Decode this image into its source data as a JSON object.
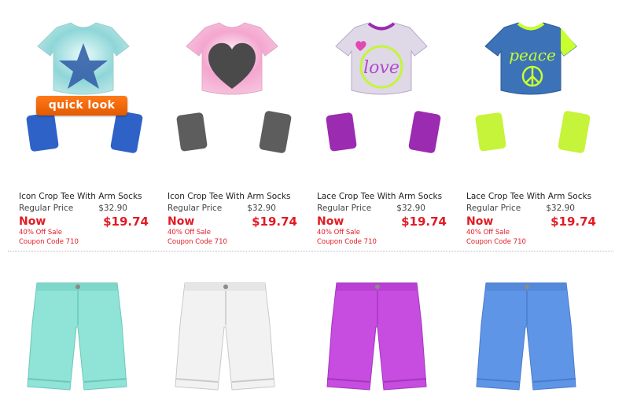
{
  "quick_look_label": "quick look",
  "products": [
    {
      "name": "Icon Crop Tee With Arm Socks",
      "regular_label": "Regular Price",
      "regular_price": "$32.90",
      "now_label": "Now",
      "sale_price": "$19.74",
      "sale_note": "40% Off Sale",
      "coupon": "Coupon Code 710",
      "icon": "star-crop-tee",
      "colors": {
        "shirt": "#8fd6d8",
        "accent": "#2f5ea8",
        "socks": "#2f62c7"
      }
    },
    {
      "name": "Icon Crop Tee With Arm Socks",
      "regular_label": "Regular Price",
      "regular_price": "$32.90",
      "now_label": "Now",
      "sale_price": "$19.74",
      "sale_note": "40% Off Sale",
      "coupon": "Coupon Code 710",
      "icon": "heart-crop-tee",
      "colors": {
        "shirt": "#f4a6cf",
        "accent": "#4d4d4d",
        "socks": "#5a5a5a"
      }
    },
    {
      "name": "Lace Crop Tee With Arm Socks",
      "regular_label": "Regular Price",
      "regular_price": "$32.90",
      "now_label": "Now",
      "sale_price": "$19.74",
      "sale_note": "40% Off Sale",
      "coupon": "Coupon Code 710",
      "icon": "love-crop-tee",
      "colors": {
        "shirt": "#d9d3e3",
        "accent": "#9b2bb0",
        "socks": "#9b2bb0"
      }
    },
    {
      "name": "Lace Crop Tee With Arm Socks",
      "regular_label": "Regular Price",
      "regular_price": "$32.90",
      "now_label": "Now",
      "sale_price": "$19.74",
      "sale_note": "40% Off Sale",
      "coupon": "Coupon Code 710",
      "icon": "peace-crop-tee",
      "colors": {
        "shirt": "#3b72b8",
        "accent": "#c8ff2e",
        "socks": "#c6f43a"
      }
    }
  ],
  "shorts": [
    {
      "icon": "mint-bermuda-shorts",
      "color": "#8fe3d7"
    },
    {
      "icon": "white-bermuda-shorts",
      "color": "#f2f2f2"
    },
    {
      "icon": "purple-bermuda-shorts",
      "color": "#c64de0"
    },
    {
      "icon": "blue-bermuda-shorts",
      "color": "#5f95e6"
    }
  ]
}
